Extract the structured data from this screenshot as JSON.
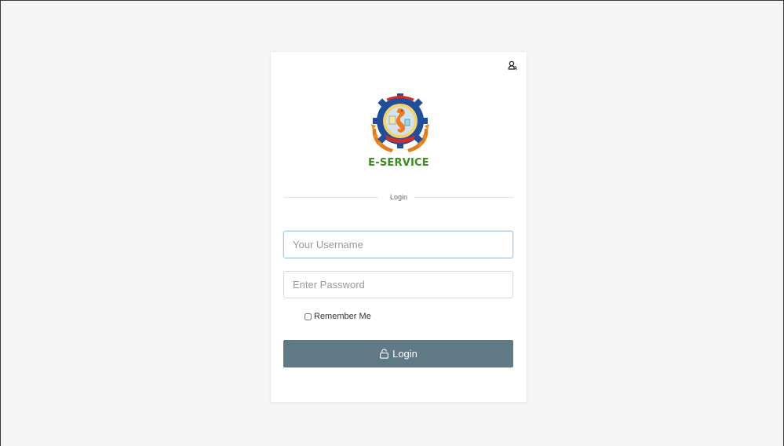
{
  "page": {
    "background": "#f5f5f5"
  },
  "card": {
    "corner_icon": "user-search-icon",
    "brand": "E-SERVICE",
    "brand_color": "#3a8c1f",
    "logo_icon": "seahorse-emblem-logo"
  },
  "login_form": {
    "divider_label": "Login",
    "username": {
      "value": "",
      "placeholder": "Your Username"
    },
    "password": {
      "value": "",
      "placeholder": "Enter Password"
    },
    "remember_me": {
      "label": "Remember Me",
      "checked": false
    },
    "submit": {
      "label": "Login",
      "icon": "unlock-icon",
      "color": "#607987"
    }
  }
}
